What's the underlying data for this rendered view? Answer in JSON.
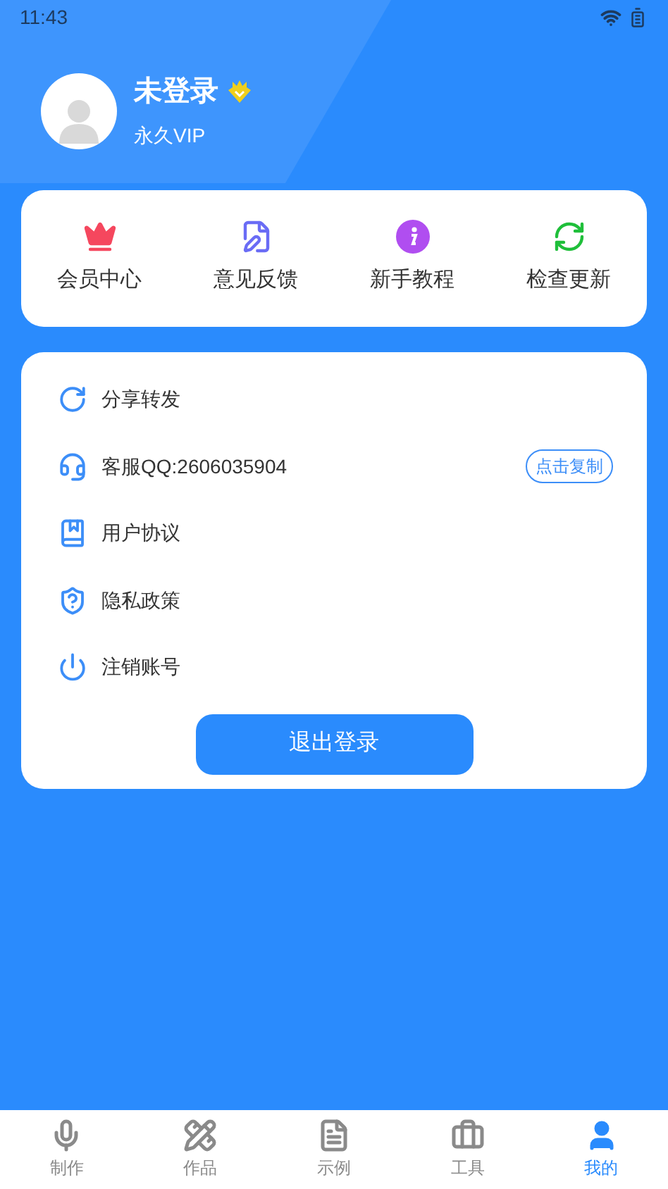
{
  "status_bar": {
    "time": "11:43"
  },
  "profile": {
    "name": "未登录",
    "membership": "永久VIP"
  },
  "quick_actions": [
    {
      "label": "会员中心"
    },
    {
      "label": "意见反馈"
    },
    {
      "label": "新手教程"
    },
    {
      "label": "检查更新"
    }
  ],
  "menu": [
    {
      "label": "分享转发"
    },
    {
      "label": "客服QQ:2606035904",
      "action": "点击复制"
    },
    {
      "label": "用户协议"
    },
    {
      "label": "隐私政策"
    },
    {
      "label": "注销账号"
    }
  ],
  "logout_button": "退出登录",
  "bottom_nav": [
    {
      "label": "制作",
      "selected": false
    },
    {
      "label": "作品",
      "selected": false
    },
    {
      "label": "示例",
      "selected": false
    },
    {
      "label": "工具",
      "selected": false
    },
    {
      "label": "我的",
      "selected": true
    }
  ]
}
